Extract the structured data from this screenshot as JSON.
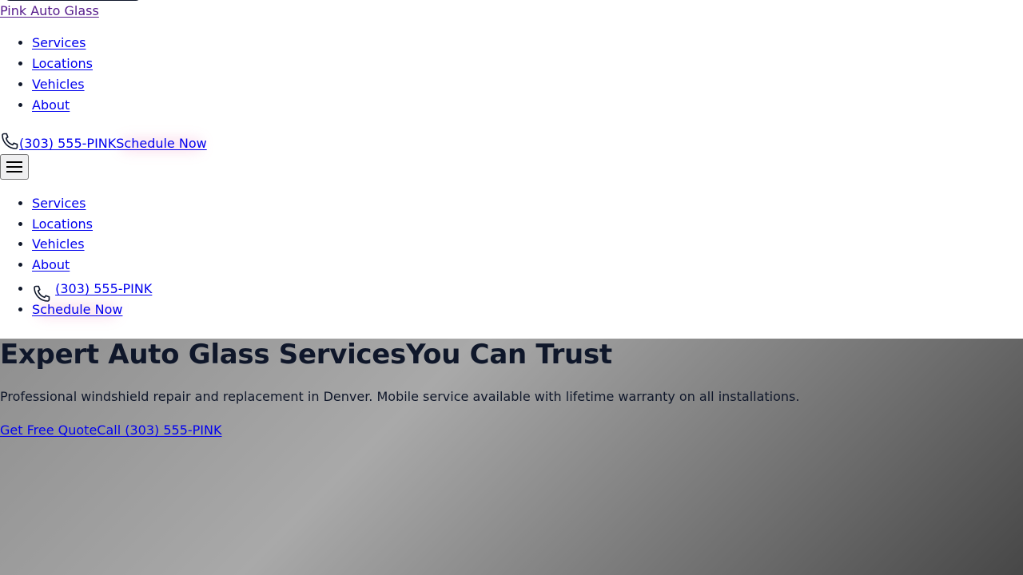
{
  "header": {
    "brand_name": "Pink Auto Glass",
    "nav_items": [
      {
        "label": "Services"
      },
      {
        "label": "Locations"
      },
      {
        "label": "Vehicles"
      },
      {
        "label": "About"
      }
    ],
    "phone_label": "(303) 555-PINK",
    "phone_icon": "phone-icon",
    "schedule_label": "Schedule Now",
    "menu_icon": "hamburger-menu-icon"
  },
  "mobile_menu": {
    "items": [
      {
        "label": "Services"
      },
      {
        "label": "Locations"
      },
      {
        "label": "Vehicles"
      },
      {
        "label": "About"
      }
    ],
    "phone_label": "(303) 555-PINK",
    "schedule_label": "Schedule Now"
  },
  "hero": {
    "title_part1": "Expert Auto Glass Services",
    "title_part2": "You Can Trust",
    "subtitle": "Professional windshield repair and replacement in Denver. Mobile service available with lifetime warranty on all installations.",
    "primary_cta": "Get Free Quote",
    "secondary_cta": "Call (303) 555-PINK"
  },
  "colors": {
    "link": "#0000ee",
    "visited_link": "#551a8b",
    "heading": "#0f172a",
    "glow_accent": "#ec4899"
  }
}
